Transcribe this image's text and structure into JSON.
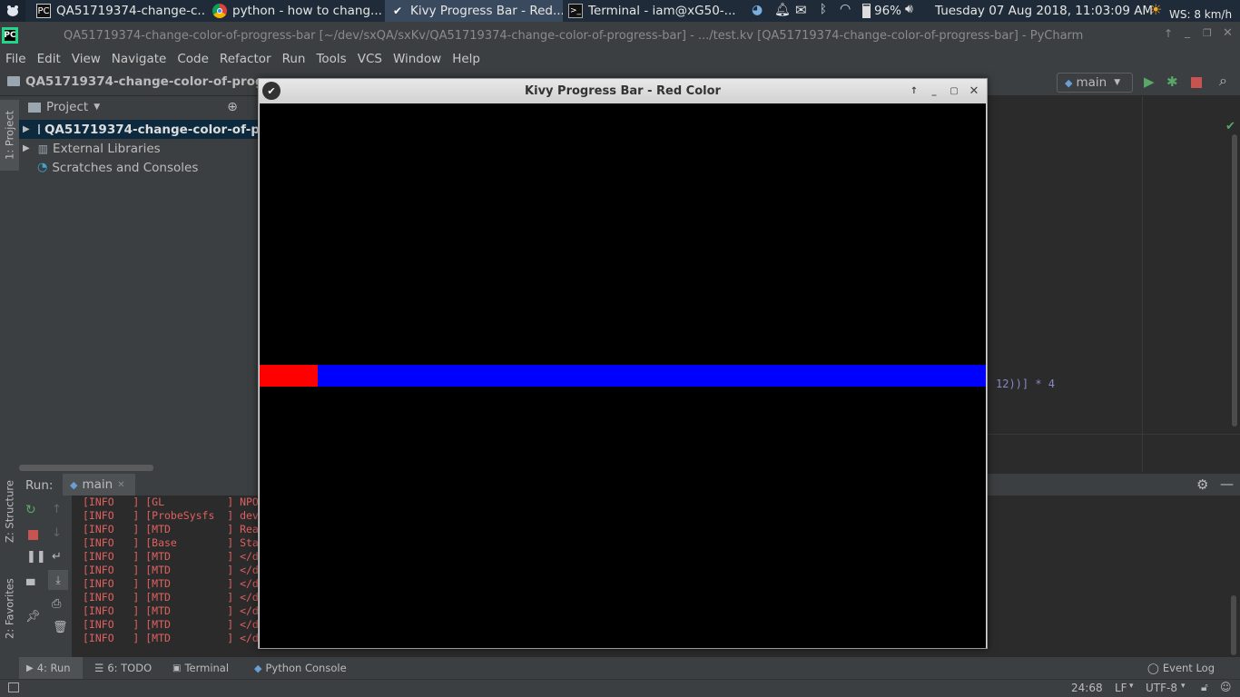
{
  "taskbar": {
    "tasks": [
      {
        "label": "QA51719374-change-c...",
        "icon": "pycharm-icon"
      },
      {
        "label": "python - how to chang...",
        "icon": "chrome-icon"
      },
      {
        "label": "Kivy Progress Bar - Red...",
        "icon": "kivy-icon"
      },
      {
        "label": "Terminal - iam@xG50-...",
        "icon": "terminal-icon"
      }
    ],
    "battery": "96%",
    "clock": "Tuesday 07 Aug 2018, 11:03:09 AM",
    "weather": "WS: 8 km/h"
  },
  "pycharm": {
    "title": "QA51719374-change-color-of-progress-bar [~/dev/sxQA/sxKv/QA51719374-change-color-of-progress-bar] - .../test.kv [QA51719374-change-color-of-progress-bar] - PyCharm",
    "menu": [
      "File",
      "Edit",
      "View",
      "Navigate",
      "Code",
      "Refactor",
      "Run",
      "Tools",
      "VCS",
      "Window",
      "Help"
    ],
    "breadcrumb": "QA51719374-change-color-of-progr",
    "run_config": "main"
  },
  "project": {
    "header": "Project",
    "items": [
      "QA51719374-change-color-of-p",
      "External Libraries",
      "Scratches and Consoles"
    ]
  },
  "left_tabs": {
    "project": "1: Project",
    "structure": "Z: Structure",
    "favorites": "2: Favorites"
  },
  "editor": {
    "fragment": "12))] * 4"
  },
  "run": {
    "label": "Run:",
    "tab": "main",
    "log": [
      "[INFO   ] [GL          ] NPO",
      "[INFO   ] [ProbeSysfs  ] dev",
      "[INFO   ] [MTD         ] Rea",
      "[INFO   ] [Base        ] Sta",
      "[INFO   ] [MTD         ] </d",
      "[INFO   ] [MTD         ] </d",
      "[INFO   ] [MTD         ] </d",
      "[INFO   ] [MTD         ] </d",
      "[INFO   ] [MTD         ] </d",
      "[INFO   ] [MTD         ] </d",
      "[INFO   ] [MTD         ] </d"
    ]
  },
  "bottom_tabs": {
    "run": "4: Run",
    "todo": "6: TODO",
    "terminal": "Terminal",
    "python_console": "Python Console",
    "event_log": "Event Log"
  },
  "status": {
    "position": "24:68",
    "line_sep": "LF",
    "encoding": "UTF-8"
  },
  "kivy": {
    "title": "Kivy Progress Bar - Red Color",
    "progress": 0.08,
    "fill_color": "#ff0000",
    "track_color": "#0000ff"
  }
}
